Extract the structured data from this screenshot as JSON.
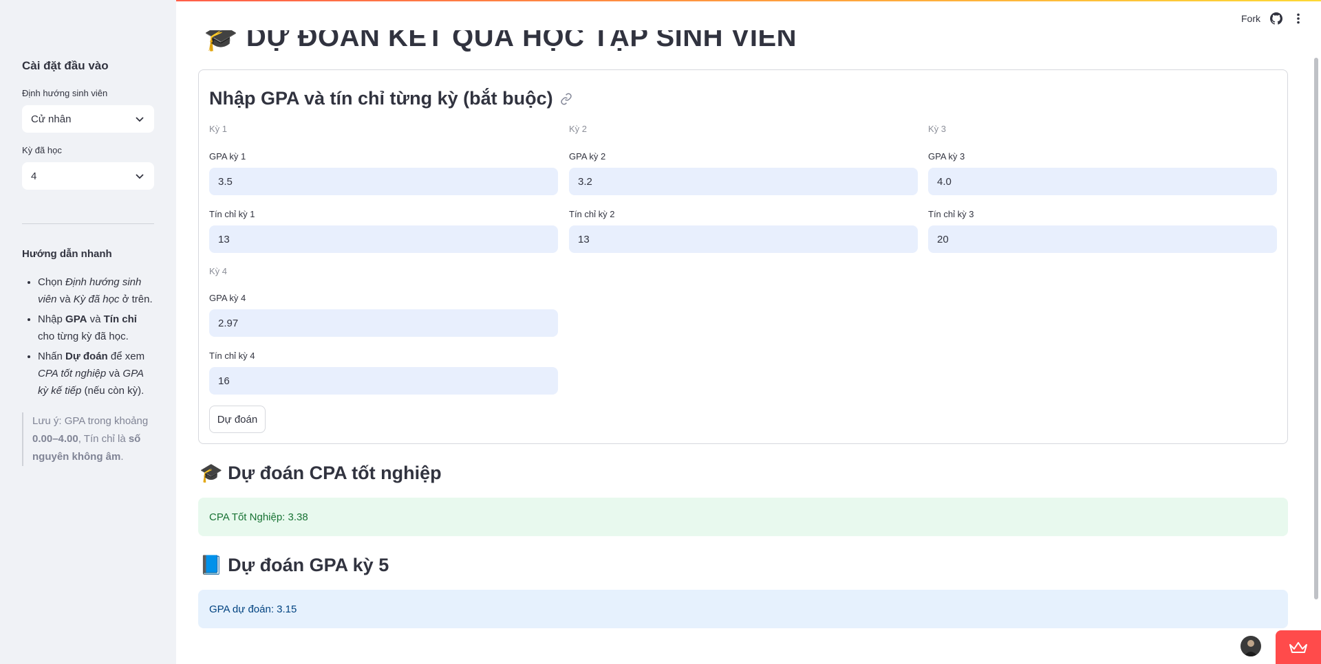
{
  "header": {
    "fork_label": "Fork"
  },
  "main_title": "🎓 DỰ ĐOÁN KẾT QUẢ HỌC TẬP SINH VIÊN",
  "sidebar": {
    "title": "Cài đặt đầu vào",
    "orientation_label": "Định hướng sinh viên",
    "orientation_value": "Cử nhân",
    "semesters_label": "Kỳ đã học",
    "semesters_value": "4",
    "guide_title": "Hướng dẫn nhanh",
    "guide_items": [
      {
        "pre": "Chọn ",
        "em1": "Định hướng sinh viên",
        "mid": " và ",
        "em2": "Kỳ đã học",
        "post": " ở trên."
      },
      {
        "pre": "Nhập ",
        "b1": "GPA",
        "mid": " và ",
        "b2": "Tín chỉ",
        "post": " cho từng kỳ đã học."
      },
      {
        "pre": "Nhấn ",
        "b1": "Dự đoán",
        "mid": " để xem ",
        "em1": "CPA tốt nghiệp",
        "mid2": " và ",
        "em2": "GPA kỳ kế tiếp",
        "post": " (nếu còn kỳ)."
      }
    ],
    "note": {
      "pre": "Lưu ý: GPA trong khoảng ",
      "b1": "0.00–4.00",
      "mid": ", Tín chỉ là ",
      "b2": "số nguyên không âm",
      "post": "."
    }
  },
  "form": {
    "title": "Nhập GPA và tín chỉ từng kỳ (bắt buộc)",
    "semesters": [
      {
        "heading": "Kỳ 1",
        "gpa_label": "GPA kỳ 1",
        "gpa": "3.5",
        "credit_label": "Tín chỉ kỳ 1",
        "credit": "13"
      },
      {
        "heading": "Kỳ 2",
        "gpa_label": "GPA kỳ 2",
        "gpa": "3.2",
        "credit_label": "Tín chỉ kỳ 2",
        "credit": "13"
      },
      {
        "heading": "Kỳ 3",
        "gpa_label": "GPA kỳ 3",
        "gpa": "4.0",
        "credit_label": "Tín chỉ kỳ 3",
        "credit": "20"
      },
      {
        "heading": "Kỳ 4",
        "gpa_label": "GPA kỳ 4",
        "gpa": "2.97",
        "credit_label": "Tín chỉ kỳ 4",
        "credit": "16"
      }
    ],
    "submit_label": "Dự đoán"
  },
  "results": {
    "cpa_heading": "🎓 Dự đoán CPA tốt nghiệp",
    "cpa_text": "CPA Tốt Nghiệp: 3.38",
    "gpa_heading": "📘 Dự đoán GPA kỳ 5",
    "gpa_text": "GPA dự đoán: 3.15"
  },
  "colors": {
    "accent": "#ff4b4b",
    "input_bg": "#e8effd",
    "success_bg": "#e8f9ee",
    "info_bg": "#e6f1fd"
  }
}
